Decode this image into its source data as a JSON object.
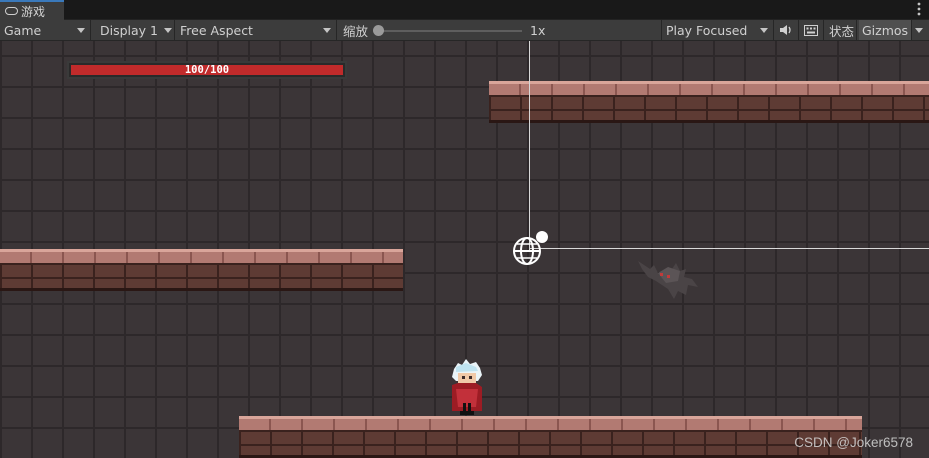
{
  "tab": {
    "label": "游戏",
    "icon": "gamepad-icon"
  },
  "toolbar": {
    "view_select": "Game",
    "display_select": "Display 1",
    "aspect_select": "Free Aspect",
    "scale_label": "缩放",
    "scale_value": 0,
    "scale_readout": "1x",
    "play_mode_select": "Play Focused",
    "audio_icon": "speaker-icon",
    "stats_label": "状态",
    "gizmos_label": "Gizmos"
  },
  "game": {
    "health_text": "100/100",
    "health_fraction": 1.0,
    "colors": {
      "health": "#c02b2b",
      "brick": "#3b3537",
      "platform": "#5e3b34",
      "gizmo_axis": "#d8d8d8"
    }
  },
  "watermark": "CSDN @Joker6578"
}
